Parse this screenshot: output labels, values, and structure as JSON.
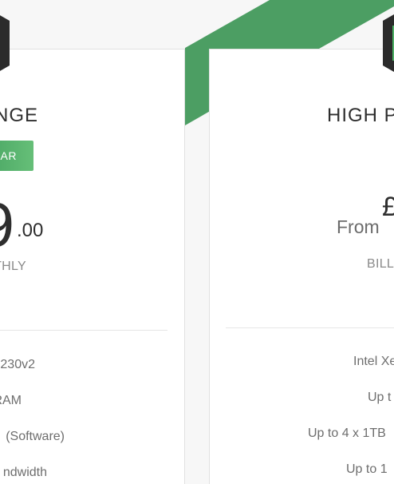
{
  "plans": [
    {
      "title": "NGE",
      "badge": "LAR",
      "price_main": "9",
      "price_cents": ".00",
      "billing": "THLY",
      "features": [
        "230v2",
        "RAM",
        "(Software)",
        "ndwidth"
      ]
    },
    {
      "title": "HIGH P",
      "price_currency": "£",
      "price_prefix": "From",
      "billing": "BILL",
      "features": [
        "Intel Xe",
        "Up t",
        "Up to 4 x 1TB",
        "Up to 1"
      ]
    }
  ],
  "colors": {
    "accent_green": "#4c9e63",
    "badge_gradient_start": "#3f9d5c",
    "badge_gradient_end": "#66bf78",
    "hex_dark": "#2b2b2b"
  },
  "icons": [
    "hexagon-badge-icon",
    "hexagon-badge-icon"
  ]
}
